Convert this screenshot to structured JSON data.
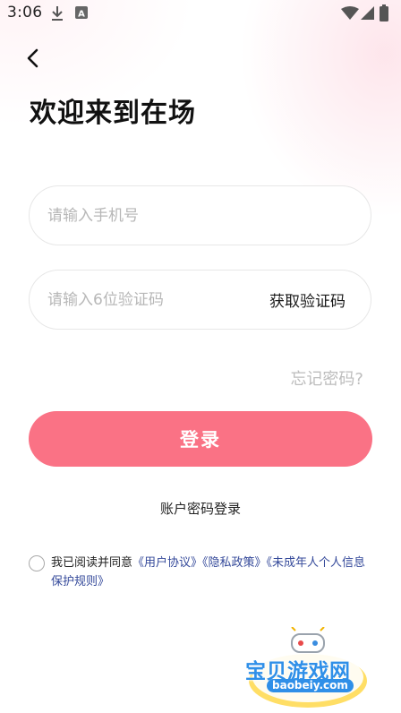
{
  "status_bar": {
    "time": "3:06",
    "icons": [
      "download-icon",
      "keyboard-a-icon",
      "wifi-icon",
      "cellular-signal-icon",
      "battery-icon"
    ]
  },
  "header": {
    "back_icon": "chevron-left-icon"
  },
  "title": "欢迎来到在场",
  "form": {
    "phone_placeholder": "请输入手机号",
    "phone_value": "",
    "code_placeholder": "请输入6位验证码",
    "code_value": "",
    "get_code_label": "获取验证码",
    "forgot_label": "忘记密码?",
    "login_label": "登录",
    "password_login_label": "账户密码登录"
  },
  "agreement": {
    "checked": false,
    "prefix": "我已阅读并同意",
    "user_agreement": "《用户协议》",
    "privacy_policy": "《隐私政策》",
    "minor_rules": "《未成年人个人信息保护规则》"
  },
  "watermark": {
    "title": "宝贝游戏网",
    "url": "baobeiy.com"
  },
  "colors": {
    "accent": "#fa7285",
    "link": "#34499a",
    "placeholder": "#b7b7b7",
    "watermark_blue": "#2f8fe8"
  }
}
